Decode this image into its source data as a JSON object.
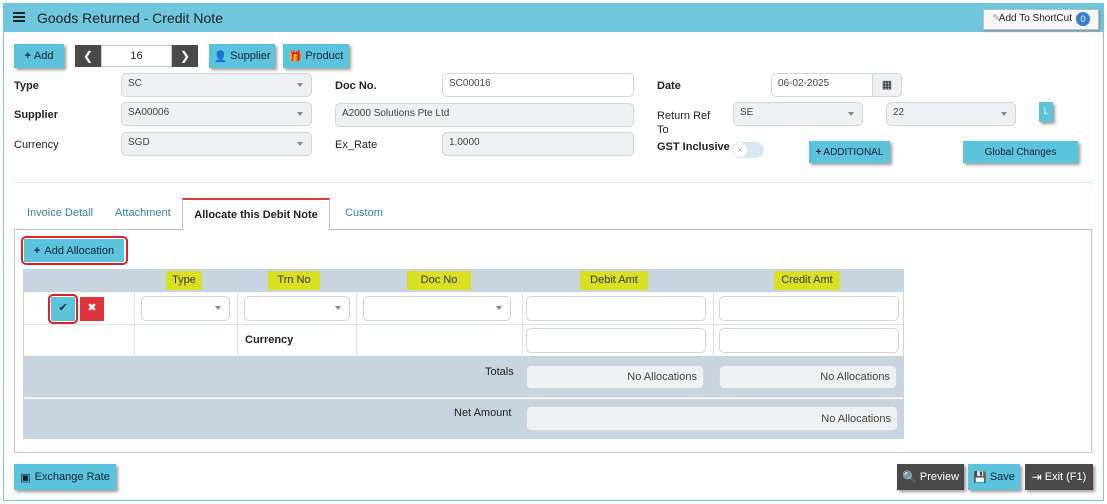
{
  "title": "Goods Returned - Credit Note",
  "shortcut": {
    "label": "Add To ShortCut",
    "count": "0"
  },
  "toolbar": {
    "add": "Add",
    "record": "16",
    "supplier": "Supplier",
    "product": "Product"
  },
  "form": {
    "type": {
      "label": "Type",
      "value": "SC"
    },
    "supplier": {
      "label": "Supplier",
      "value": "SA00006"
    },
    "currency": {
      "label": "Currency",
      "value": "SGD"
    },
    "doc_no": {
      "label": "Doc No.",
      "value": "SC00016"
    },
    "supplier_name": "A2000 Solutions Pte Ltd",
    "ex_rate": {
      "label": "Ex_Rate",
      "value": "1.0000"
    },
    "date": {
      "label": "Date",
      "value": "06-02-2025"
    },
    "return_ref": {
      "label1": "Return Ref",
      "label2": "To",
      "value1": "SE",
      "value2": "22"
    },
    "l_badge": "L",
    "gst": {
      "label": "GST Inclusive",
      "toggle": "×"
    },
    "additional": "ADDITIONAL",
    "global_changes": "Global Changes"
  },
  "tabs": [
    "Invoice Detail",
    "Attachment",
    "Allocate this Debit Note",
    "Custom"
  ],
  "allocation": {
    "add_button": "Add Allocation",
    "columns": [
      "Type",
      "Trn No",
      "Doc No",
      "Debit Amt",
      "Credit Amt"
    ],
    "currency_label": "Currency",
    "totals_label": "Totals",
    "totals_debit": "No Allocations",
    "totals_credit": "No Allocations",
    "net_label": "Net Amount",
    "net_value": "No Allocations"
  },
  "footer": {
    "exchange_rate": "Exchange Rate",
    "preview": "Preview",
    "save": "Save",
    "exit": "Exit (F1)"
  },
  "colors": {
    "accent": "#5bc4dc",
    "title_bar": "#6ec7df",
    "highlight": "#d9e021",
    "danger": "#e0343c"
  }
}
